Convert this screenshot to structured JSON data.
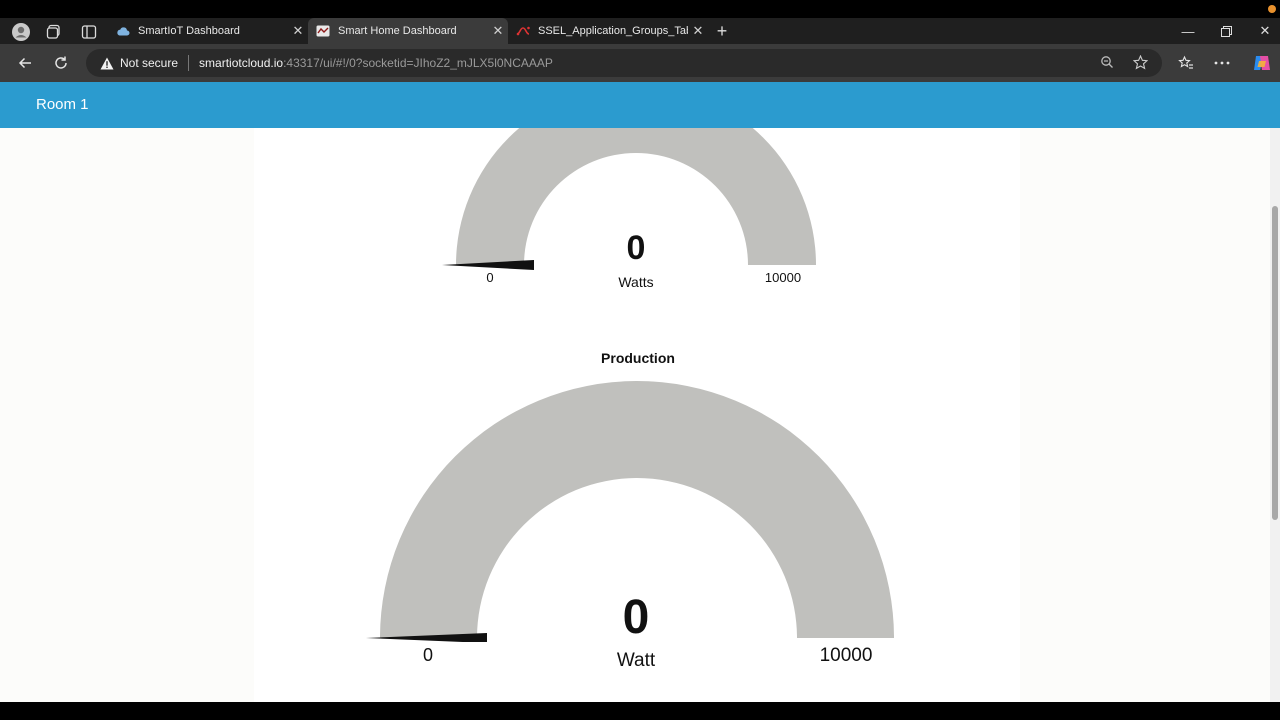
{
  "browser": {
    "tabs": [
      {
        "title": "SmartIoT Dashboard",
        "active": false
      },
      {
        "title": "Smart Home Dashboard",
        "active": true
      },
      {
        "title": "SSEL_Application_Groups_Tabs_In",
        "active": false
      }
    ],
    "security_label": "Not secure",
    "url_host": "smartiotcloud.io",
    "url_rest": ":43317/ui/#!/0?socketid=JIhoZ2_mJLX5l0NCAAAP",
    "icons": [
      "profile-icon",
      "workspaces-icon",
      "tab-actions-icon",
      "new-tab-icon",
      "back-icon",
      "reload-icon",
      "zoom-icon",
      "favorite-icon",
      "favorites-bar-icon",
      "more-icon",
      "copilot-icon",
      "minimize-icon",
      "restore-icon",
      "close-icon"
    ]
  },
  "header": {
    "title": "Room 1"
  },
  "gauges": [
    {
      "title": "",
      "value": "0",
      "unit": "Watts",
      "min": "0",
      "max": "10000",
      "level": 0
    },
    {
      "title": "Production",
      "value": "0",
      "unit": "Watt",
      "min": "0",
      "max": "10000",
      "level": 0
    }
  ],
  "colors": {
    "header": "#2b9bcf",
    "gauge_track": "#c0c0bd",
    "needle": "#111111"
  }
}
